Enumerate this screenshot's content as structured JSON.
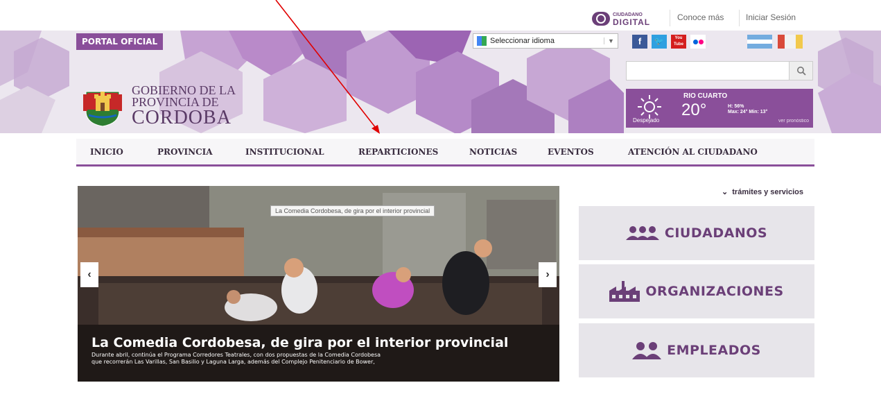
{
  "topbar": {
    "cd_logo_small": "CIUDADANO",
    "cd_logo_big": "DIGITAL",
    "conoce_mas": "Conoce más",
    "iniciar_sesion": "Iniciar Sesión"
  },
  "header": {
    "portal_label": "PORTAL OFICIAL",
    "language_select": "Seleccionar idioma",
    "gov_line1": "GOBIERNO DE LA",
    "gov_line2": "PROVINCIA DE",
    "gov_line3": "CORDOBA",
    "social": [
      "f",
      "t",
      "You Tube",
      "flickr"
    ]
  },
  "weather": {
    "city": "RIO CUARTO",
    "temp": "20°",
    "humidity": "H: 56%",
    "minmax": "Max: 24° Min: 13°",
    "condition": "Despejado",
    "more": "ver pronóstico"
  },
  "nav": {
    "items": [
      "INICIO",
      "PROVINCIA",
      "INSTITUCIONAL",
      "REPARTICIONES",
      "NOTICIAS",
      "EVENTOS",
      "ATENCIÓN AL CIUDADANO"
    ]
  },
  "slider": {
    "tag": "La Comedia Cordobesa, de gira por el interior provincial",
    "title": "La Comedia Cordobesa, de gira por el interior provincial",
    "desc_line1": "Durante abril, continúa el Programa Corredores Teatrales, con dos propuestas de la Comedia Cordobesa",
    "desc_line2": "que recorrerán Las Varillas, San Basilio y Laguna Larga, además del Complejo Penitenciario de Bower,",
    "prev": "‹",
    "next": "›"
  },
  "sidebar": {
    "tramites": "trámites y servicios",
    "buttons": [
      "CIUDADANOS",
      "ORGANIZACIONES",
      "EMPLEADOS"
    ]
  },
  "colors": {
    "brand": "#8a4f9a",
    "nav_underline": "#8a4f9a",
    "annotation": "#e00000"
  }
}
